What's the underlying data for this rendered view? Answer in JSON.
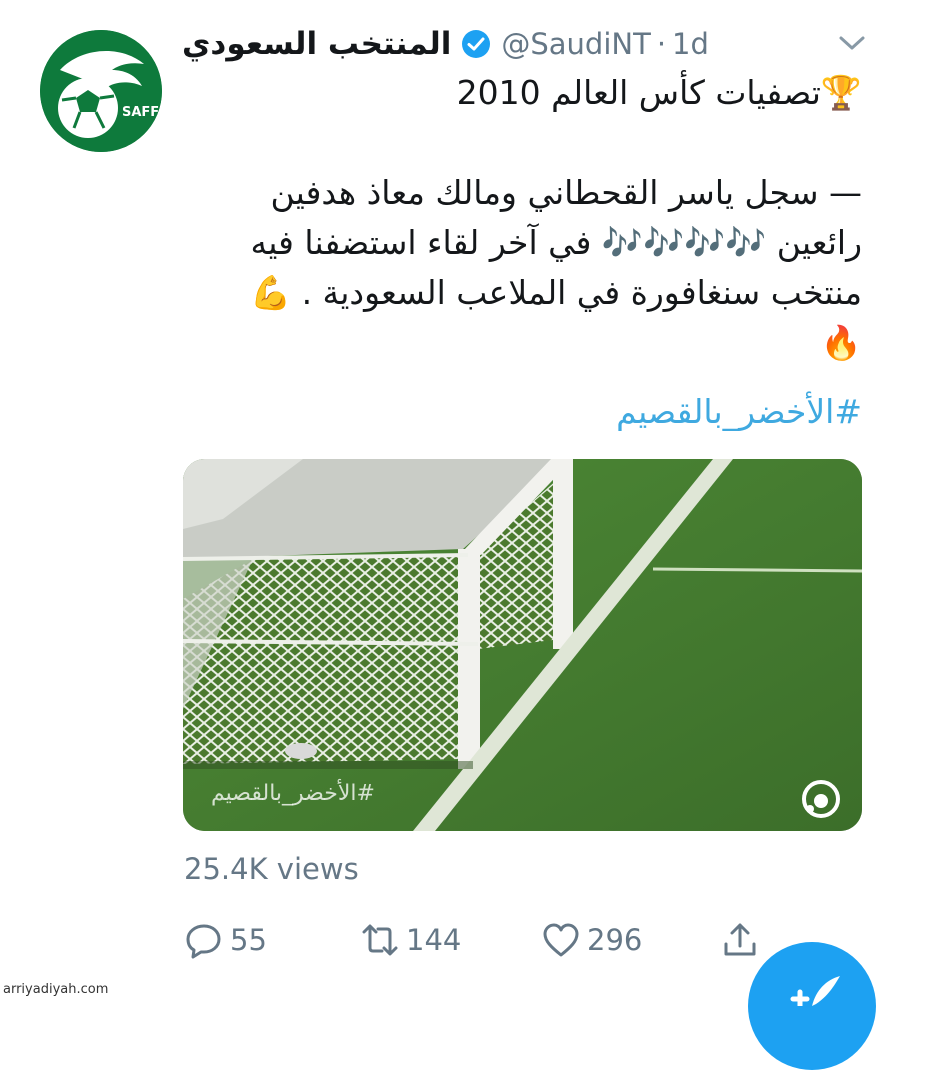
{
  "account": {
    "display_name": "المنتخب السعودي",
    "handle": "@SaudiNT",
    "separator": "·",
    "age": "1d",
    "avatar_logo_text": "SAFF"
  },
  "tweet": {
    "lines": [
      "🏆تصفيات كأس العالم 2010",
      "",
      "— سجل ياسر القحطاني ومالك معاذ هدفين",
      "رائعين 🎶🎶🎶🎶 في آخر لقاء استضفنا فيه",
      "منتخب سنغافورة في الملاعب السعودية . 💪",
      "🔥"
    ],
    "hashtag": "#الأخضر_بالقصيم"
  },
  "media": {
    "watermark": "#الأخضر_بالقصيم",
    "type_icon": "gif-play-icon"
  },
  "stats": {
    "views": "25.4K views",
    "replies": "55",
    "retweets": "144",
    "likes": "296"
  },
  "footer": {
    "source": "arriyadiyah.com"
  },
  "colors": {
    "brand_blue": "#1da1f2",
    "hashtag_blue": "#3fa9e0",
    "secondary_text": "#657786",
    "saff_green": "#0e7a3c"
  }
}
